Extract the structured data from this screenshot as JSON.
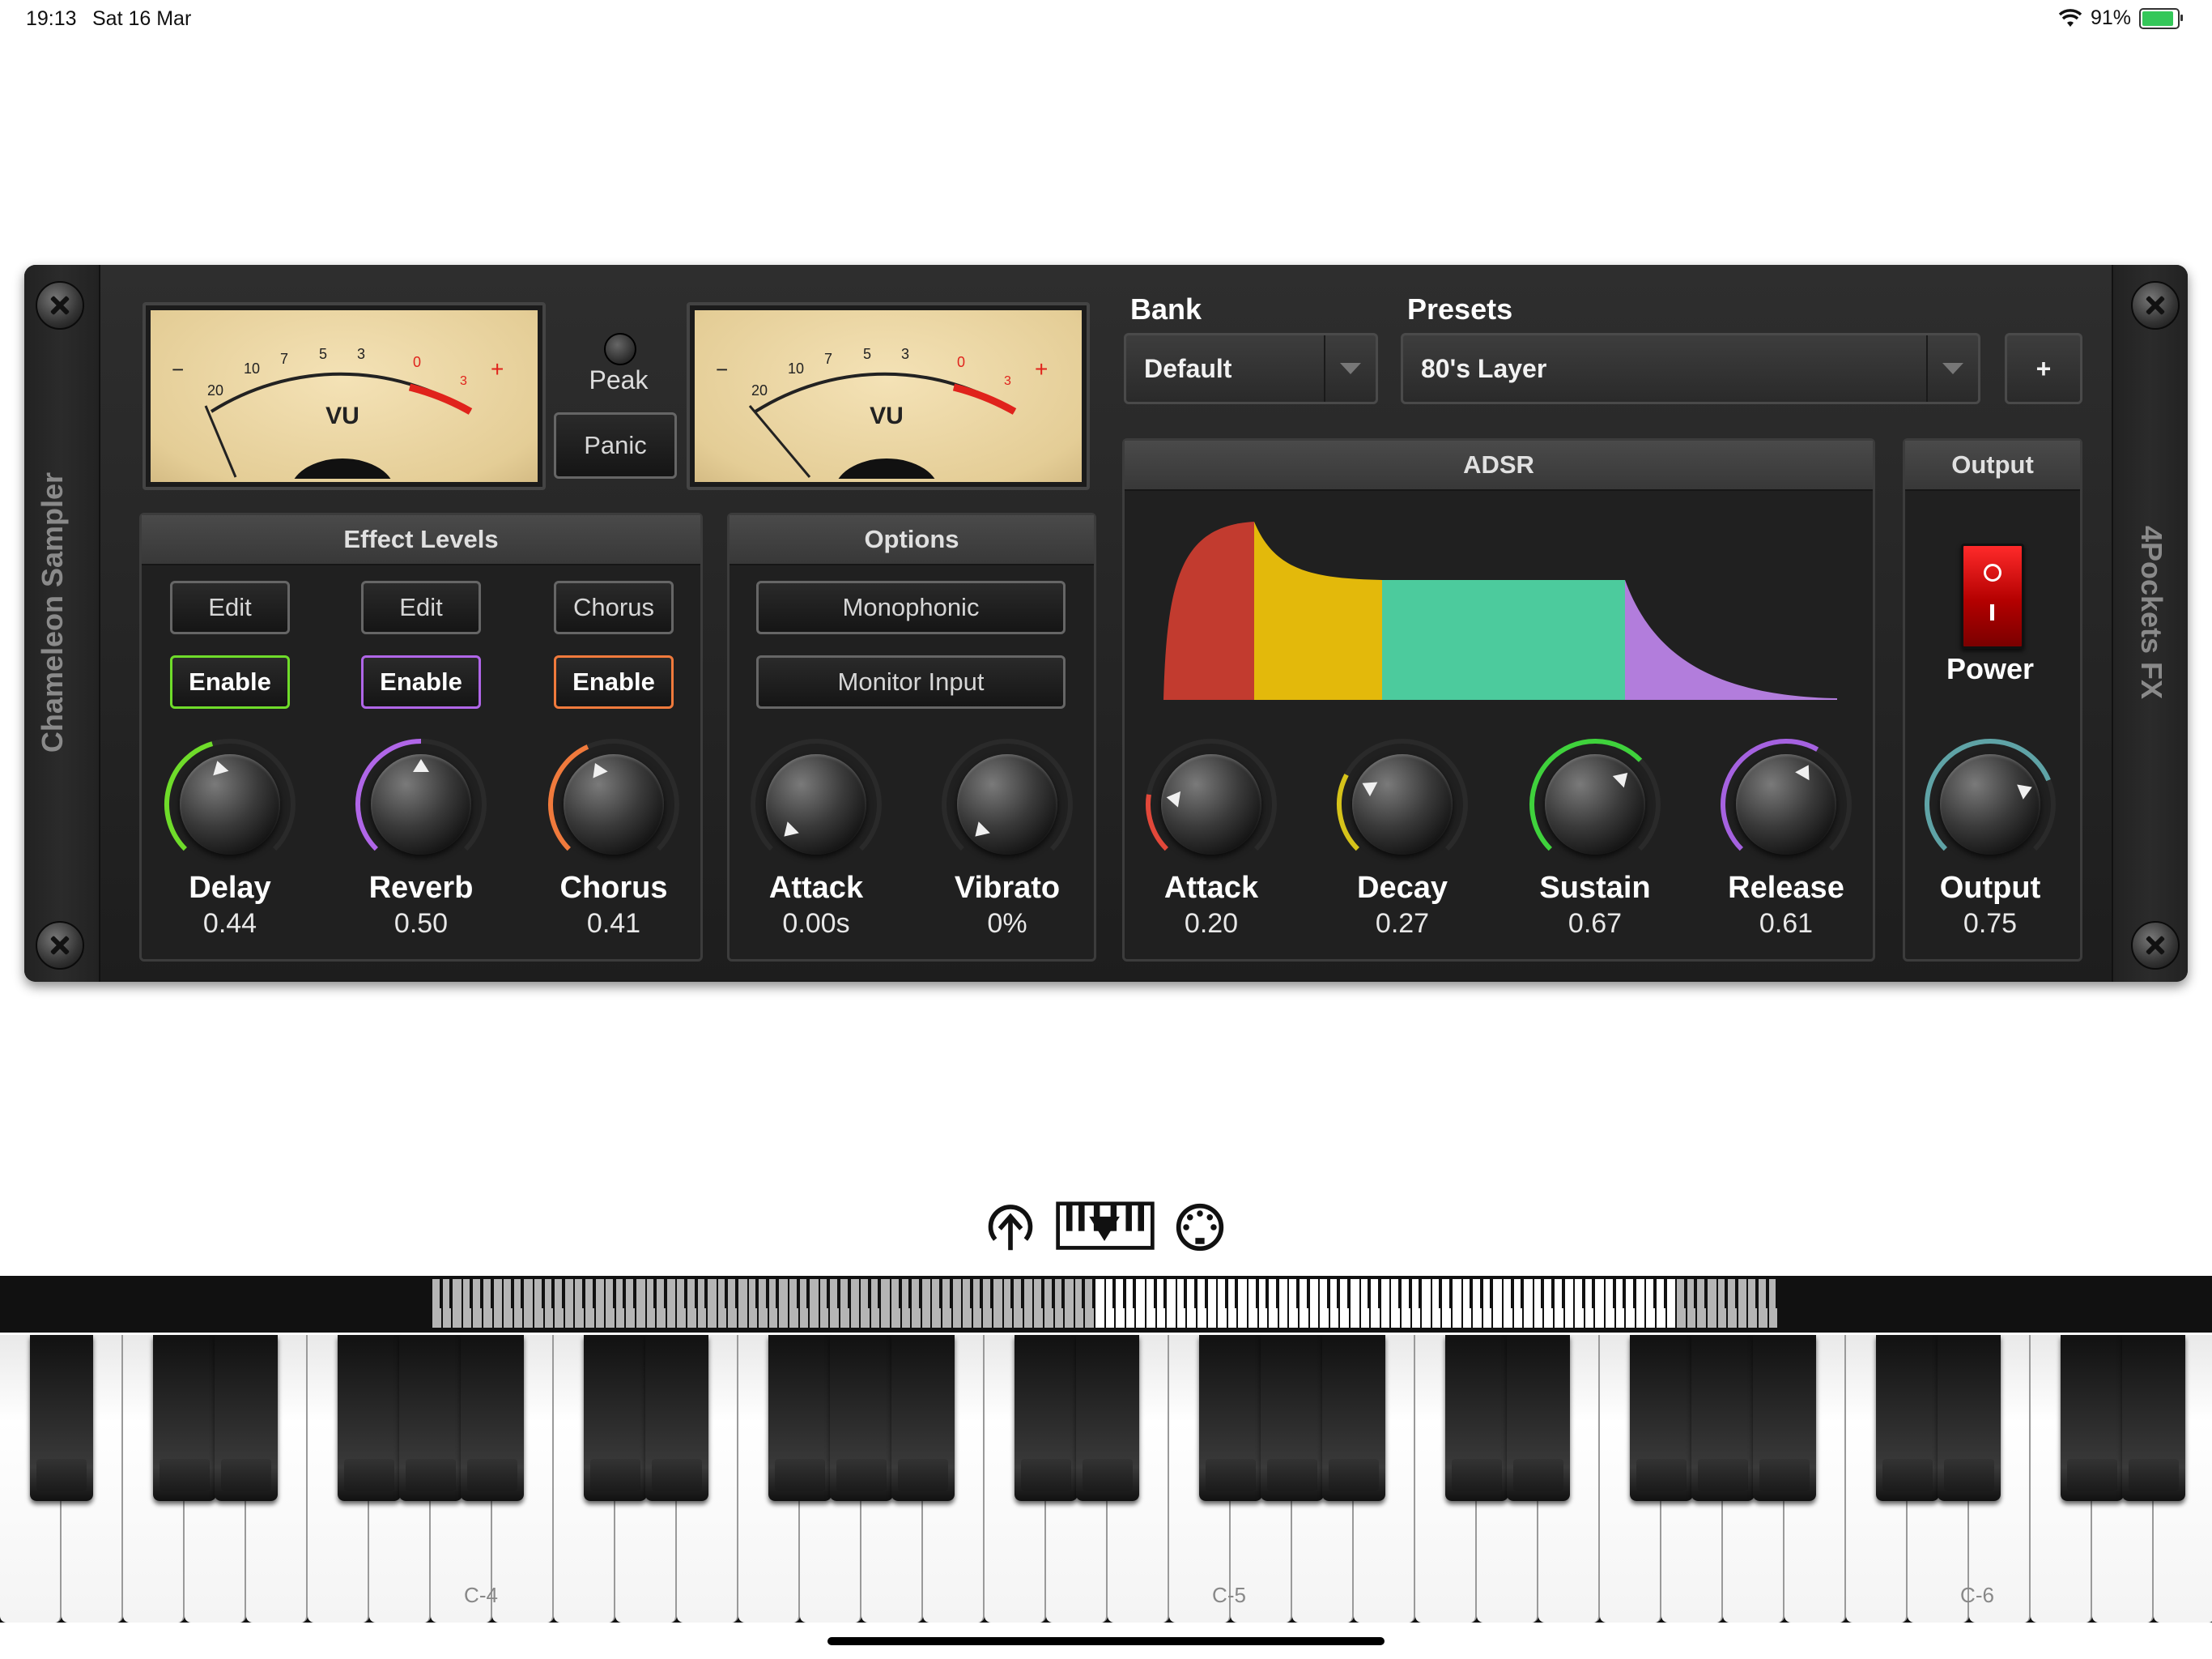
{
  "status_bar": {
    "time": "19:13",
    "date": "Sat 16 Mar",
    "battery": "91%",
    "battery_level": 0.91
  },
  "rack": {
    "left_title": "Chameleon Sampler",
    "right_title": "4Pockets FX",
    "vu_left_label": "VU",
    "vu_right_label": "VU",
    "vu_scale": [
      "20",
      "10",
      "7",
      "5",
      "3",
      "0",
      "3"
    ],
    "vu_minus": "−",
    "vu_plus": "+",
    "peak_label": "Peak",
    "panic_label": "Panic",
    "bank": {
      "label": "Bank",
      "value": "Default"
    },
    "presets": {
      "label": "Presets",
      "value": "80's Layer",
      "add_label": "+"
    },
    "effect_levels": {
      "title": "Effect Levels",
      "columns": [
        {
          "top_button": "Edit",
          "enable": "Enable",
          "knob": "Delay",
          "value": "0.44",
          "level": 0.44,
          "color": "#6fdc2a"
        },
        {
          "top_button": "Edit",
          "enable": "Enable",
          "knob": "Reverb",
          "value": "0.50",
          "level": 0.5,
          "color": "#b066e8"
        },
        {
          "top_button": "Chorus",
          "enable": "Enable",
          "knob": "Chorus",
          "value": "0.41",
          "level": 0.41,
          "color": "#f07a3c"
        }
      ]
    },
    "options": {
      "title": "Options",
      "buttons": [
        "Monophonic",
        "Monitor Input"
      ],
      "knobs": [
        {
          "label": "Attack",
          "value": "0.00s",
          "level": 0.0
        },
        {
          "label": "Vibrato",
          "value": "0%",
          "level": 0.0
        }
      ]
    },
    "adsr": {
      "title": "ADSR",
      "colors": [
        "#c23b2f",
        "#e3b90b",
        "#4ccb9d",
        "#b27ddc"
      ],
      "knobs": [
        {
          "label": "Attack",
          "value": "0.20",
          "level": 0.2,
          "color": "#e2483a"
        },
        {
          "label": "Decay",
          "value": "0.27",
          "level": 0.27,
          "color": "#d6c31a"
        },
        {
          "label": "Sustain",
          "value": "0.67",
          "level": 0.67,
          "color": "#3fd23c"
        },
        {
          "label": "Release",
          "value": "0.61",
          "level": 0.61,
          "color": "#a562e0"
        }
      ]
    },
    "output": {
      "title": "Output",
      "power_label": "Power",
      "knob": {
        "label": "Output",
        "value": "0.75",
        "level": 0.75,
        "color": "#5fa3a6"
      }
    }
  },
  "keyboard": {
    "toolbar_icons": [
      "upload-arrow-icon",
      "keyboard-range-icon",
      "midi-port-icon"
    ],
    "note_labels": [
      "C-4",
      "C-5",
      "C-6"
    ]
  }
}
